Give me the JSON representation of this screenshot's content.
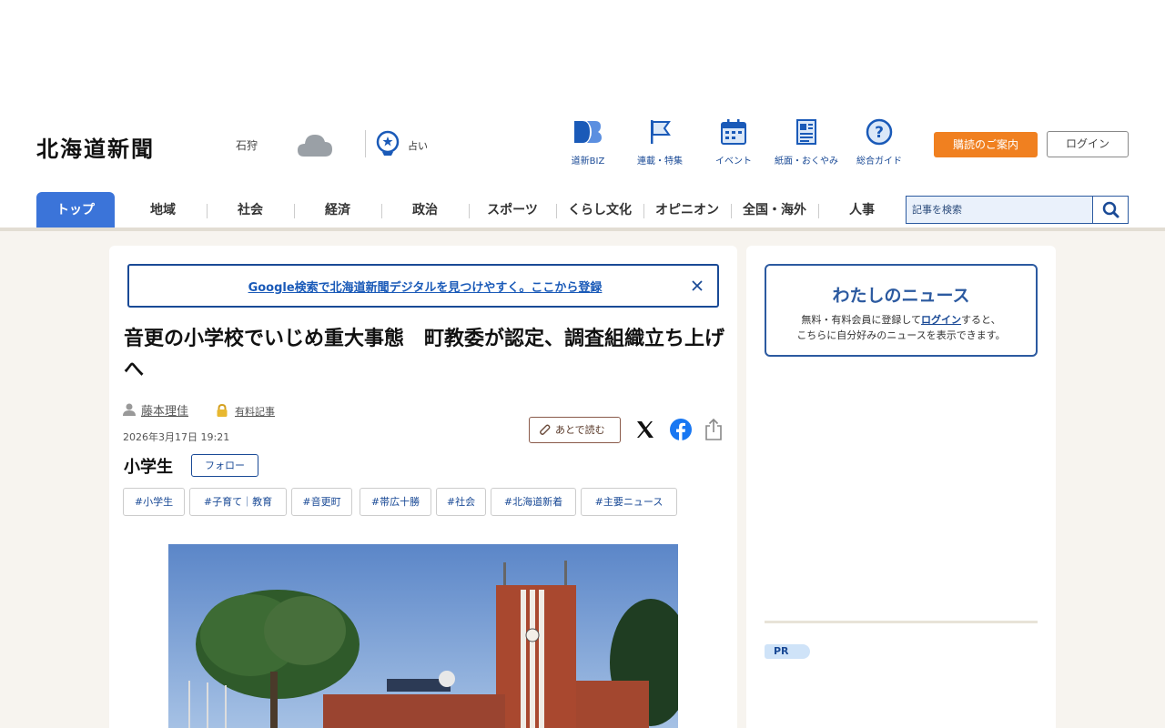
{
  "header": {
    "logo": "北海道新聞",
    "region": "石狩",
    "weather_icon": "cloud-icon",
    "fortune_label": "占い",
    "icons": [
      {
        "label": "道新BIZ",
        "icon": "db-logo-icon"
      },
      {
        "label": "連載・特集",
        "icon": "flag-icon"
      },
      {
        "label": "イベント",
        "icon": "calendar-icon"
      },
      {
        "label": "紙面・おくやみ",
        "icon": "newspaper-icon"
      },
      {
        "label": "総合ガイド",
        "icon": "help-icon"
      }
    ],
    "subscribe": "購読のご案内",
    "login": "ログイン"
  },
  "nav": {
    "items": [
      "トップ",
      "地域",
      "社会",
      "経済",
      "政治",
      "スポーツ",
      "くらし文化",
      "オピニオン",
      "全国・海外",
      "人事"
    ],
    "active": "トップ"
  },
  "search": {
    "placeholder": "記事を検索"
  },
  "article": {
    "promo": "Google検索で北海道新聞デジタルを見つけやすく。ここから登録",
    "headline": "音更の小学校でいじめ重大事態　町教委が認定、調査組織立ち上げへ",
    "author": "藤本理佳",
    "paid_label": "有料記事",
    "date": "2026年3月17日 19:21",
    "read_later": "あとで読む",
    "topic": "小学生",
    "follow": "フォロー",
    "tags": [
      "#小学生",
      "#子育て｜教育",
      "#音更町",
      "#帯広十勝",
      "#社会",
      "#北海道新着",
      "#主要ニュース"
    ]
  },
  "sidebar": {
    "mynews_title": "わたしのニュース",
    "mynews_pre": "無料・有料会員に登録して",
    "mynews_link": "ログイン",
    "mynews_post": "すると、",
    "mynews_line2": "こちらに自分好みのニュースを表示できます。",
    "pr_label": "PR"
  },
  "colors": {
    "brand_blue": "#1a4a96",
    "nav_active": "#3b74d9",
    "subscribe_orange": "#f08020",
    "background": "#f7f4ef"
  }
}
